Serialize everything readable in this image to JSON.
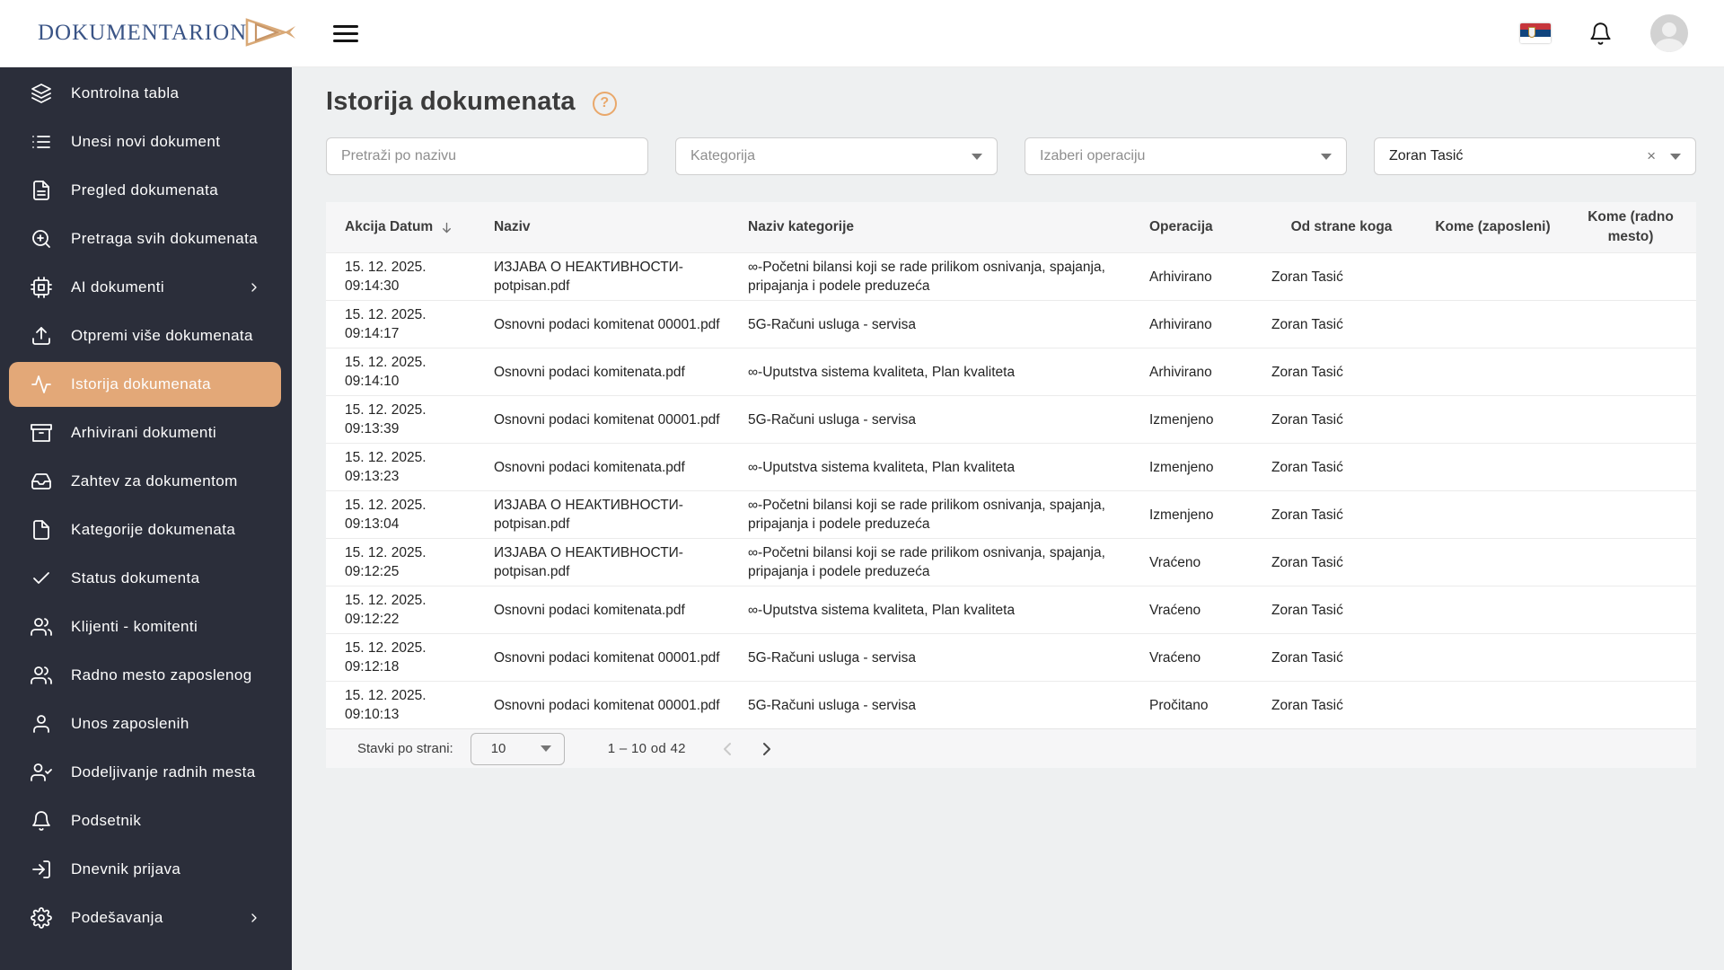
{
  "colors": {
    "sidebar_bg": "#2b2e3a",
    "active_item_bg": "#e3a878",
    "accent_orange": "#e9a86b",
    "logo_navy": "#3a5486",
    "main_bg": "#eef0f1",
    "flag_red": "#c6363c",
    "flag_blue": "#11457e"
  },
  "topbar": {
    "logo_text": "DOKUMENTARION",
    "icons": [
      "hamburger-icon",
      "serbia-flag",
      "bell-icon",
      "avatar"
    ]
  },
  "sidebar": {
    "items": [
      {
        "label": "Kontrolna tabla",
        "icon": "layers",
        "active": false,
        "has_submenu": false
      },
      {
        "label": "Unesi novi dokument",
        "icon": "list",
        "active": false,
        "has_submenu": false
      },
      {
        "label": "Pregled dokumenata",
        "icon": "file-text",
        "active": false,
        "has_submenu": false
      },
      {
        "label": "Pretraga svih dokumenata",
        "icon": "search-plus",
        "active": false,
        "has_submenu": false
      },
      {
        "label": "AI dokumenti",
        "icon": "cpu",
        "active": false,
        "has_submenu": true
      },
      {
        "label": "Otpremi više dokumenata",
        "icon": "upload",
        "active": false,
        "has_submenu": false
      },
      {
        "label": "Istorija dokumenata",
        "icon": "activity",
        "active": true,
        "has_submenu": false
      },
      {
        "label": "Arhivirani dokumenti",
        "icon": "archive",
        "active": false,
        "has_submenu": false
      },
      {
        "label": "Zahtev za dokumentom",
        "icon": "inbox",
        "active": false,
        "has_submenu": false
      },
      {
        "label": "Kategorije dokumenata",
        "icon": "file",
        "active": false,
        "has_submenu": false
      },
      {
        "label": "Status dokumenta",
        "icon": "check",
        "active": false,
        "has_submenu": false
      },
      {
        "label": "Klijenti - komitenti",
        "icon": "users",
        "active": false,
        "has_submenu": false
      },
      {
        "label": "Radno mesto zaposlenog",
        "icon": "users",
        "active": false,
        "has_submenu": false
      },
      {
        "label": "Unos zaposlenih",
        "icon": "user",
        "active": false,
        "has_submenu": false
      },
      {
        "label": "Dodeljivanje radnih mesta",
        "icon": "user-check",
        "active": false,
        "has_submenu": false
      },
      {
        "label": "Podsetnik",
        "icon": "bell",
        "active": false,
        "has_submenu": false
      },
      {
        "label": "Dnevnik prijava",
        "icon": "log-in",
        "active": false,
        "has_submenu": false
      },
      {
        "label": "Podešavanja",
        "icon": "settings",
        "active": false,
        "has_submenu": true
      }
    ]
  },
  "page": {
    "title": "Istorija dokumenata",
    "help_icon": "?"
  },
  "filters": {
    "search_placeholder": "Pretraži po nazivu",
    "category_placeholder": "Kategorija",
    "operation_placeholder": "Izaberi operaciju",
    "person_value": "Zoran Tasić",
    "clear_symbol": "×"
  },
  "table": {
    "columns": [
      "Akcija Datum",
      "Naziv",
      "Naziv kategorije",
      "Operacija",
      "Od strane koga",
      "Kome (zaposleni)",
      "Kome (radno mesto)"
    ],
    "rows": [
      {
        "date": "15. 12. 2025.",
        "time": "09:14:30",
        "naziv": "ИЗЈАВА О НЕАКТИВНОСТИ-potpisan.pdf",
        "kategorija": "∞-Početni bilansi koji se rade prilikom osnivanja, spajanja, pripajanja i podele preduzeća",
        "operacija": "Arhivirano",
        "od_strane": "Zoran Tasić",
        "kome_zaposleni": "",
        "kome_radno": ""
      },
      {
        "date": "15. 12. 2025.",
        "time": "09:14:17",
        "naziv": "Osnovni podaci komitenat 00001.pdf",
        "kategorija": "5G-Računi usluga - servisa",
        "operacija": "Arhivirano",
        "od_strane": "Zoran Tasić",
        "kome_zaposleni": "",
        "kome_radno": ""
      },
      {
        "date": "15. 12. 2025.",
        "time": "09:14:10",
        "naziv": "Osnovni podaci komitenata.pdf",
        "kategorija": "∞-Uputstva sistema kvaliteta, Plan kvaliteta",
        "operacija": "Arhivirano",
        "od_strane": "Zoran Tasić",
        "kome_zaposleni": "",
        "kome_radno": ""
      },
      {
        "date": "15. 12. 2025.",
        "time": "09:13:39",
        "naziv": "Osnovni podaci komitenat 00001.pdf",
        "kategorija": "5G-Računi usluga - servisa",
        "operacija": "Izmenjeno",
        "od_strane": "Zoran Tasić",
        "kome_zaposleni": "",
        "kome_radno": ""
      },
      {
        "date": "15. 12. 2025.",
        "time": "09:13:23",
        "naziv": "Osnovni podaci komitenata.pdf",
        "kategorija": "∞-Uputstva sistema kvaliteta, Plan kvaliteta",
        "operacija": "Izmenjeno",
        "od_strane": "Zoran Tasić",
        "kome_zaposleni": "",
        "kome_radno": ""
      },
      {
        "date": "15. 12. 2025.",
        "time": "09:13:04",
        "naziv": "ИЗЈАВА О НЕАКТИВНОСТИ-potpisan.pdf",
        "kategorija": "∞-Početni bilansi koji se rade prilikom osnivanja, spajanja, pripajanja i podele preduzeća",
        "operacija": "Izmenjeno",
        "od_strane": "Zoran Tasić",
        "kome_zaposleni": "",
        "kome_radno": ""
      },
      {
        "date": "15. 12. 2025.",
        "time": "09:12:25",
        "naziv": "ИЗЈАВА О НЕАКТИВНОСТИ-potpisan.pdf",
        "kategorija": "∞-Početni bilansi koji se rade prilikom osnivanja, spajanja, pripajanja i podele preduzeća",
        "operacija": "Vraćeno",
        "od_strane": "Zoran Tasić",
        "kome_zaposleni": "",
        "kome_radno": ""
      },
      {
        "date": "15. 12. 2025.",
        "time": "09:12:22",
        "naziv": "Osnovni podaci komitenata.pdf",
        "kategorija": "∞-Uputstva sistema kvaliteta, Plan kvaliteta",
        "operacija": "Vraćeno",
        "od_strane": "Zoran Tasić",
        "kome_zaposleni": "",
        "kome_radno": ""
      },
      {
        "date": "15. 12. 2025.",
        "time": "09:12:18",
        "naziv": "Osnovni podaci komitenat 00001.pdf",
        "kategorija": "5G-Računi usluga - servisa",
        "operacija": "Vraćeno",
        "od_strane": "Zoran Tasić",
        "kome_zaposleni": "",
        "kome_radno": ""
      },
      {
        "date": "15. 12. 2025.",
        "time": "09:10:13",
        "naziv": "Osnovni podaci komitenat 00001.pdf",
        "kategorija": "5G-Računi usluga - servisa",
        "operacija": "Pročitano",
        "od_strane": "Zoran Tasić",
        "kome_zaposleni": "",
        "kome_radno": ""
      }
    ]
  },
  "pagination": {
    "items_per_page_label": "Stavki po strani:",
    "items_per_page": "10",
    "range_text": "1 – 10 od 42"
  }
}
